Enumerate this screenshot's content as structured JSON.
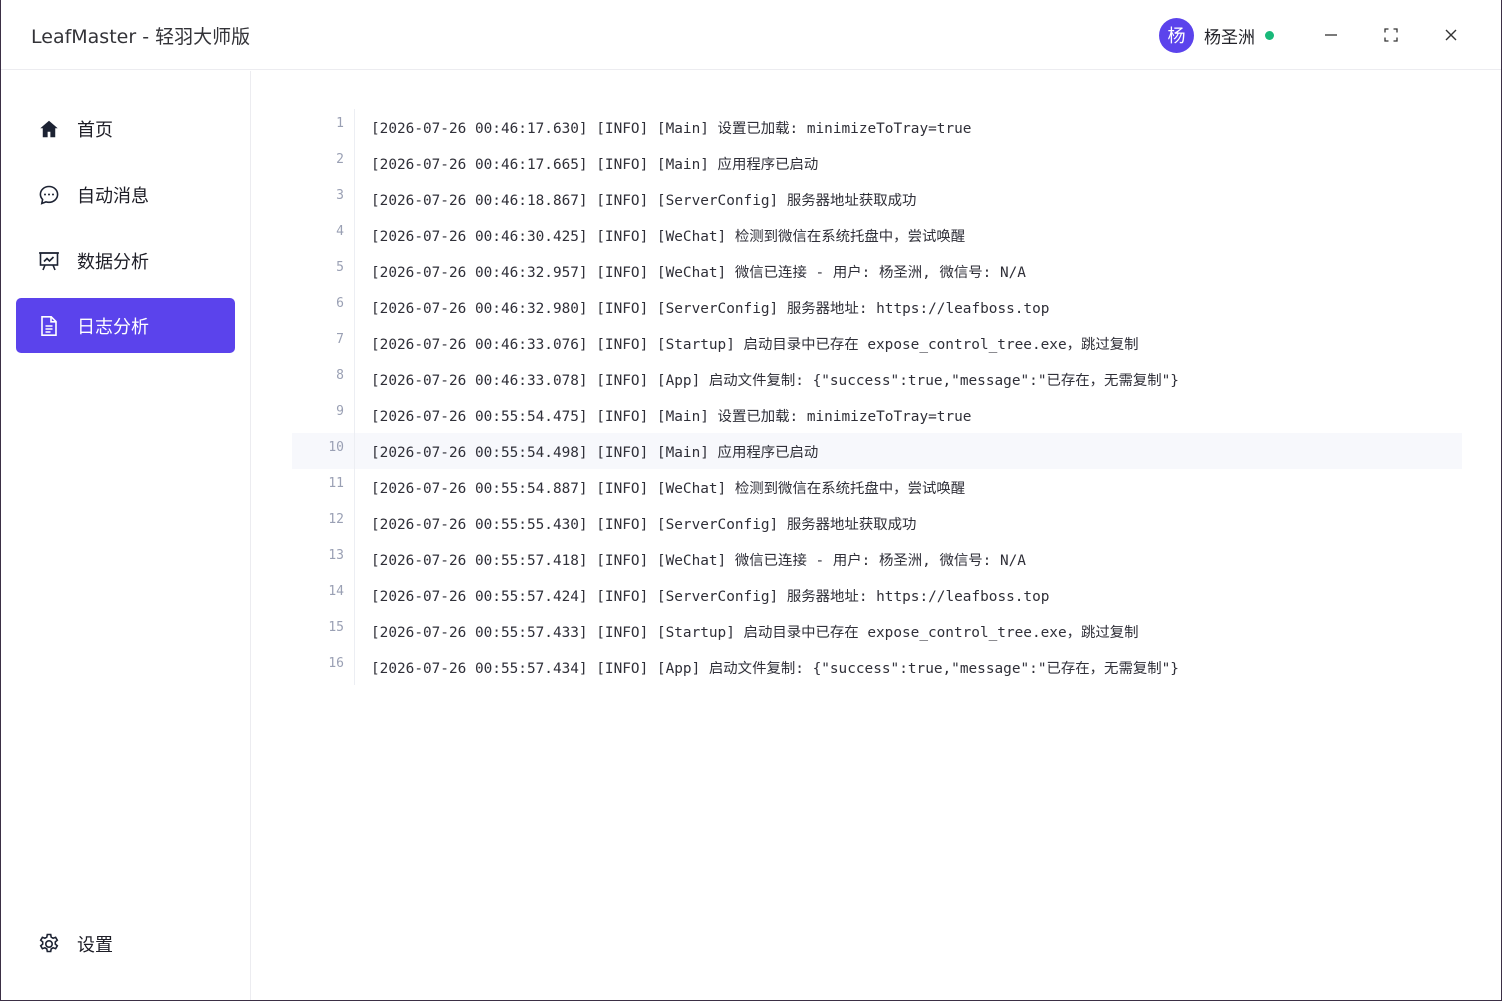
{
  "window": {
    "title": "LeafMaster - 轻羽大师版"
  },
  "user": {
    "avatar_text": "杨",
    "name": "杨圣洲",
    "status_color": "#19b97a"
  },
  "sidebar": {
    "items": [
      {
        "label": "首页",
        "icon": "home-icon"
      },
      {
        "label": "自动消息",
        "icon": "chat-bubble-icon"
      },
      {
        "label": "数据分析",
        "icon": "presentation-chart-icon"
      },
      {
        "label": "日志分析",
        "icon": "document-icon",
        "active": true
      }
    ],
    "settings_label": "设置"
  },
  "colors": {
    "accent": "#5b43ec",
    "online": "#19b97a"
  },
  "log": {
    "highlighted_line": 10,
    "lines": [
      {
        "no": "1",
        "text": "[2026-07-26 00:46:17.630] [INFO] [Main] 设置已加载: minimizeToTray=true"
      },
      {
        "no": "2",
        "text": "[2026-07-26 00:46:17.665] [INFO] [Main] 应用程序已启动"
      },
      {
        "no": "3",
        "text": "[2026-07-26 00:46:18.867] [INFO] [ServerConfig] 服务器地址获取成功"
      },
      {
        "no": "4",
        "text": "[2026-07-26 00:46:30.425] [INFO] [WeChat] 检测到微信在系统托盘中，尝试唤醒"
      },
      {
        "no": "5",
        "text": "[2026-07-26 00:46:32.957] [INFO] [WeChat] 微信已连接 - 用户: 杨圣洲, 微信号: N/A"
      },
      {
        "no": "6",
        "text": "[2026-07-26 00:46:32.980] [INFO] [ServerConfig] 服务器地址: https://leafboss.top"
      },
      {
        "no": "7",
        "text": "[2026-07-26 00:46:33.076] [INFO] [Startup] 启动目录中已存在 expose_control_tree.exe，跳过复制"
      },
      {
        "no": "8",
        "text": "[2026-07-26 00:46:33.078] [INFO] [App] 启动文件复制: {\"success\":true,\"message\":\"已存在，无需复制\"}"
      },
      {
        "no": "9",
        "text": "[2026-07-26 00:55:54.475] [INFO] [Main] 设置已加载: minimizeToTray=true"
      },
      {
        "no": "10",
        "text": "[2026-07-26 00:55:54.498] [INFO] [Main] 应用程序已启动"
      },
      {
        "no": "11",
        "text": "[2026-07-26 00:55:54.887] [INFO] [WeChat] 检测到微信在系统托盘中，尝试唤醒"
      },
      {
        "no": "12",
        "text": "[2026-07-26 00:55:55.430] [INFO] [ServerConfig] 服务器地址获取成功"
      },
      {
        "no": "13",
        "text": "[2026-07-26 00:55:57.418] [INFO] [WeChat] 微信已连接 - 用户: 杨圣洲, 微信号: N/A"
      },
      {
        "no": "14",
        "text": "[2026-07-26 00:55:57.424] [INFO] [ServerConfig] 服务器地址: https://leafboss.top"
      },
      {
        "no": "15",
        "text": "[2026-07-26 00:55:57.433] [INFO] [Startup] 启动目录中已存在 expose_control_tree.exe，跳过复制"
      },
      {
        "no": "16",
        "text": "[2026-07-26 00:55:57.434] [INFO] [App] 启动文件复制: {\"success\":true,\"message\":\"已存在，无需复制\"}"
      }
    ]
  }
}
